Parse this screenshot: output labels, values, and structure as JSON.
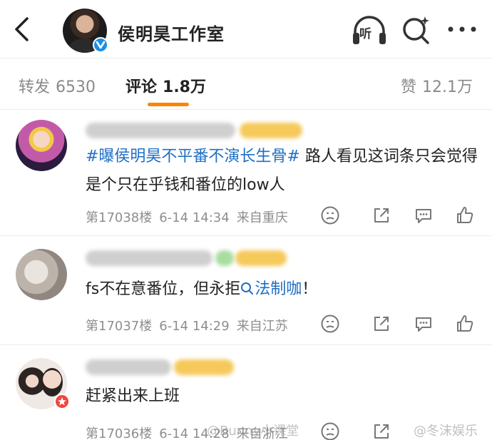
{
  "header": {
    "title": "侯明昊工作室",
    "listen_label": "听"
  },
  "tabs": [
    {
      "label": "转发",
      "count": "6530"
    },
    {
      "label": "评论",
      "count": "1.8万"
    },
    {
      "label": "赞",
      "count": "12.1万"
    }
  ],
  "comments": [
    {
      "hashtag": "#曝侯明昊不平番不演长生骨#",
      "text": " 路人看见这词条只会觉得是个只在乎钱和番位的low人",
      "floor": "第17038楼",
      "time": "6-14 14:34",
      "location": "来自重庆"
    },
    {
      "text_before": "fs不在意番位，但永拒",
      "search_term": "法制咖",
      "text_after": "！",
      "floor": "第17037楼",
      "time": "6-14 14:29",
      "location": "来自江苏"
    },
    {
      "text": "赶紧出来上班",
      "floor": "第17036楼",
      "time": "6-14 14:28",
      "location": "来自浙江"
    }
  ],
  "watermarks": {
    "left": "@Bunny小课堂",
    "right": "@冬沫娱乐"
  },
  "colors": {
    "accent_orange": "#ff8200",
    "link_blue": "#1f6fc5",
    "verified_blue": "#1c8fe6",
    "badge_red": "#f0463c"
  }
}
